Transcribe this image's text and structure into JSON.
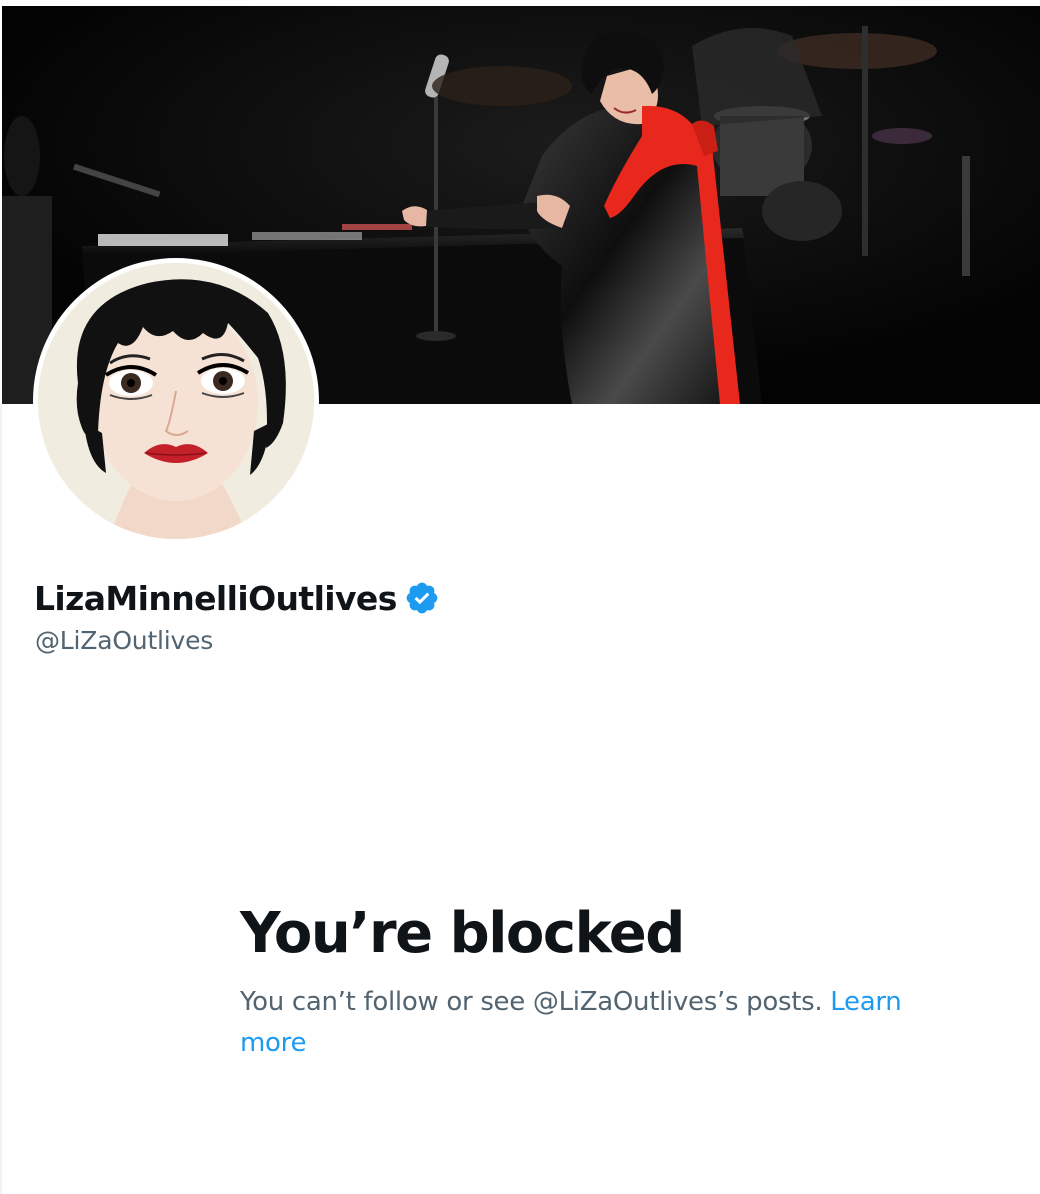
{
  "profile": {
    "display_name": "LizaMinnelliOutlives",
    "handle": "@LiZaOutlives",
    "verified": true,
    "verified_badge_color": "#1d9bf0"
  },
  "blocked": {
    "title": "You’re blocked",
    "description": "You can’t follow or see @LiZaOutlives’s posts.",
    "learn_more_label": "Learn more",
    "link_color": "#1d9bf0"
  },
  "colors": {
    "text_primary": "#0f1419",
    "text_secondary": "#536471",
    "banner_background": "#050505",
    "scarf_red": "#e8281c"
  }
}
